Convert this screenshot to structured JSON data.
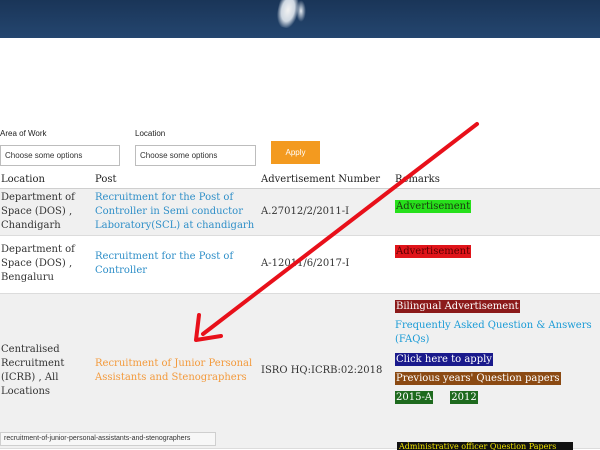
{
  "filters": {
    "area_label": "Area of Work",
    "area_placeholder": "Choose some options",
    "location_label": "Location",
    "location_placeholder": "Choose some options",
    "apply_label": "Apply"
  },
  "table": {
    "headers": [
      "Location",
      "Post",
      "Advertisement Number",
      "Remarks"
    ],
    "rows": [
      {
        "location": "Department of Space (DOS) , Chandigarh",
        "post": "Recruitment for the Post of Controller in Semi conductor Laboratory(SCL) at chandigarh",
        "adv_number": "A.27012/2/2011-I",
        "remarks": [
          "Advertisement"
        ]
      },
      {
        "location": "Department of Space (DOS) , Bengaluru",
        "post": "Recruitment for the Post of Controller",
        "adv_number": "A-12011/6/2017-I",
        "remarks": [
          "Advertisement"
        ]
      },
      {
        "location": "Centralised Recruitment (ICRB) , All Locations",
        "post": "Recruitment of Junior Personal Assistants and Stenographers",
        "adv_number": "ISRO HQ:ICRB:02:2018",
        "remarks": [
          "Bilingual Advertisement",
          "Frequently Asked Question & Answers (FAQs)",
          "Click here to apply",
          "Previous years' Question papers",
          "2015-A",
          "2012"
        ]
      }
    ],
    "next_remark": "Administrative officer Question Papers"
  },
  "statusbar": {
    "url": "recruitment-of-junior-personal-assistants-and-stenographers"
  },
  "colors": {
    "accent": "#f39a1f",
    "link": "#2f8fc8",
    "link_hover": "#f39a3c",
    "annotation_arrow": "#e8101a"
  }
}
